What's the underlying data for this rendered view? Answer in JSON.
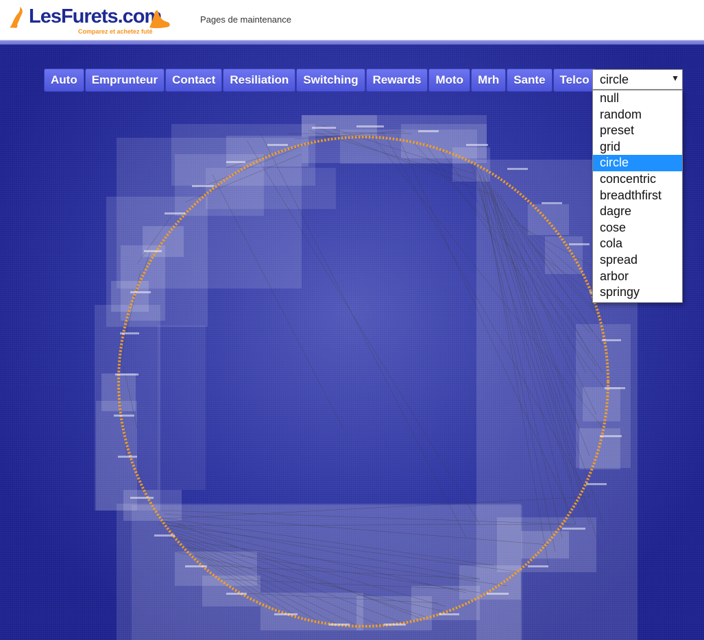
{
  "brand": {
    "name_main": "LesFurets",
    "name_suffix": ".com",
    "tagline": "Comparez et achetez futé",
    "orange": "#f7931e",
    "navy": "#1e2a93"
  },
  "header": {
    "title": "Pages de maintenance"
  },
  "toolbar": {
    "buttons": [
      "Auto",
      "Emprunteur",
      "Contact",
      "Resiliation",
      "Switching",
      "Rewards",
      "Moto",
      "Mrh",
      "Sante",
      "Telco"
    ]
  },
  "layout_select": {
    "value": "circle",
    "arrow_icon": "triangle-down-icon",
    "options": [
      "null",
      "random",
      "preset",
      "grid",
      "circle",
      "concentric",
      "breadthfirst",
      "dagre",
      "cose",
      "cola",
      "spread",
      "arbor",
      "springy"
    ]
  },
  "colors": {
    "background": "#1a1f8c",
    "button": "#5a62e6",
    "selected_option": "#1e90ff",
    "node": "#f7a020"
  }
}
